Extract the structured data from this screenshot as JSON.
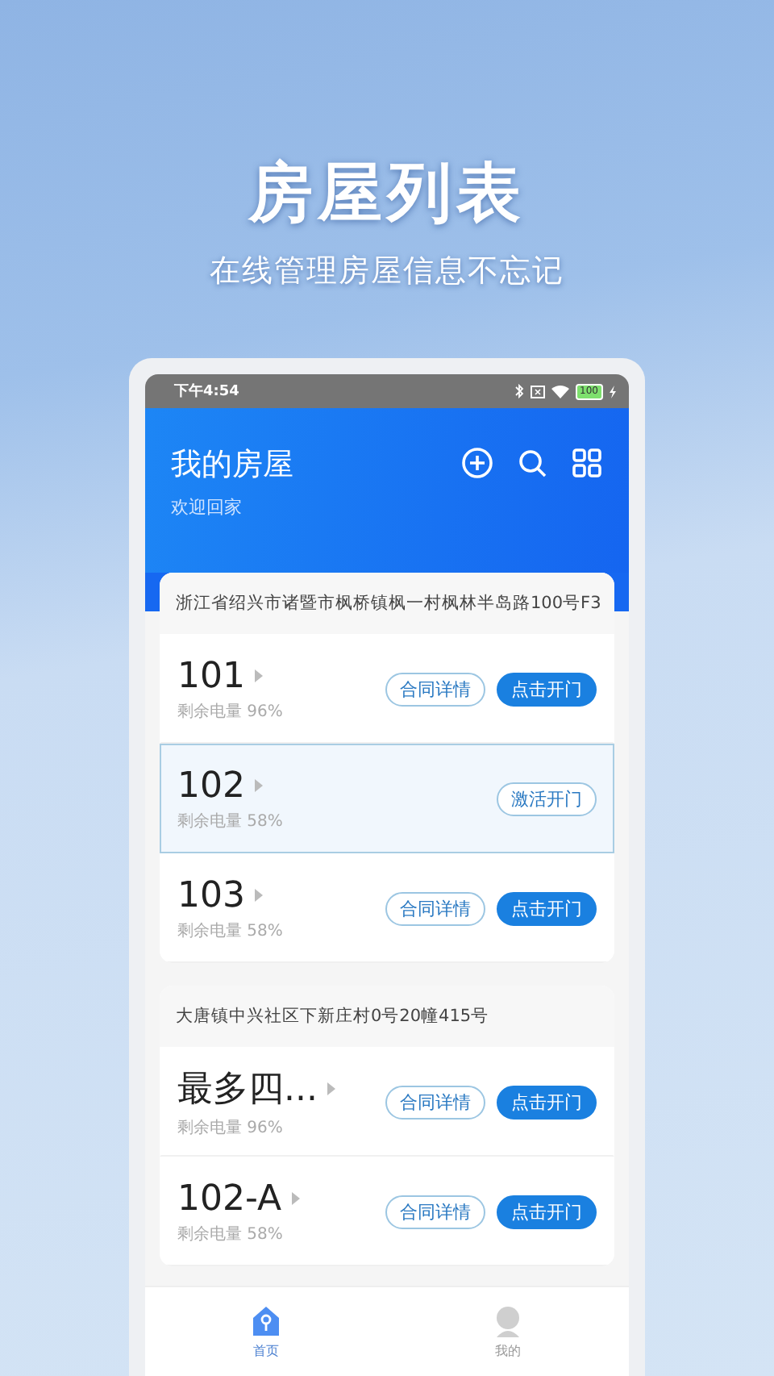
{
  "promo": {
    "title": "房屋列表",
    "subtitle": "在线管理房屋信息不忘记"
  },
  "status_bar": {
    "time": "下午4:54",
    "battery": "100"
  },
  "header": {
    "title": "我的房屋",
    "subtitle": "欢迎回家"
  },
  "properties": [
    {
      "address": "浙江省绍兴市诸暨市枫桥镇枫一村枫林半岛路100号F3",
      "rooms": [
        {
          "name": "101",
          "battery": "剩余电量 96%",
          "selected": false,
          "buttons": [
            {
              "kind": "outline",
              "label": "合同详情"
            },
            {
              "kind": "filled",
              "label": "点击开门"
            }
          ]
        },
        {
          "name": "102",
          "battery": "剩余电量 58%",
          "selected": true,
          "buttons": [
            {
              "kind": "outline",
              "label": "激活开门"
            }
          ]
        },
        {
          "name": "103",
          "battery": "剩余电量 58%",
          "selected": false,
          "buttons": [
            {
              "kind": "outline",
              "label": "合同详情"
            },
            {
              "kind": "filled",
              "label": "点击开门"
            }
          ]
        }
      ]
    },
    {
      "address": "大唐镇中兴社区下新庄村0号20幢415号",
      "rooms": [
        {
          "name": "最多四...",
          "battery": "剩余电量 96%",
          "selected": false,
          "buttons": [
            {
              "kind": "outline",
              "label": "合同详情"
            },
            {
              "kind": "filled",
              "label": "点击开门"
            }
          ]
        },
        {
          "name": "102-A",
          "battery": "剩余电量 58%",
          "selected": false,
          "buttons": [
            {
              "kind": "outline",
              "label": "合同详情"
            },
            {
              "kind": "filled",
              "label": "点击开门"
            }
          ]
        }
      ]
    }
  ],
  "tabs": [
    {
      "label": "首页",
      "kind": "home",
      "selected": true
    },
    {
      "label": "我的",
      "kind": "profile",
      "selected": false
    }
  ]
}
